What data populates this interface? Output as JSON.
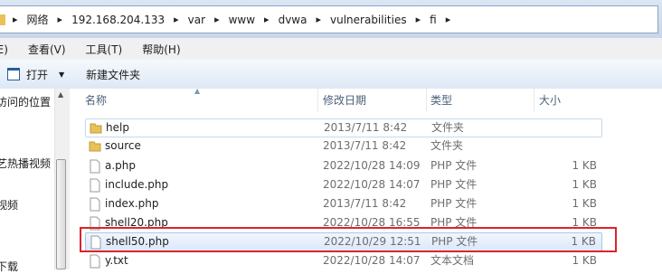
{
  "address": {
    "crumbs": [
      "网络",
      "192.168.204.133",
      "var",
      "www",
      "dvwa",
      "vulnerabilities",
      "fi"
    ]
  },
  "menu": {
    "items": [
      "编辑(E)",
      "查看(V)",
      "工具(T)",
      "帮助(H)"
    ]
  },
  "toolbar": {
    "open_label": "打开",
    "new_folder_label": "新建文件夹"
  },
  "nav": {
    "items": [
      "访问的位置",
      "艺热播视频",
      "视频",
      "下载"
    ]
  },
  "columns": {
    "name": "名称",
    "date": "修改日期",
    "type": "类型",
    "size": "大小"
  },
  "files": [
    {
      "name": "help",
      "date": "2013/7/11 8:42",
      "type": "文件夹",
      "size": "",
      "kind": "folder"
    },
    {
      "name": "source",
      "date": "2013/7/11 8:42",
      "type": "文件夹",
      "size": "",
      "kind": "folder"
    },
    {
      "name": "a.php",
      "date": "2022/10/28 14:09",
      "type": "PHP 文件",
      "size": "1 KB",
      "kind": "file"
    },
    {
      "name": "include.php",
      "date": "2022/10/28 14:07",
      "type": "PHP 文件",
      "size": "1 KB",
      "kind": "file"
    },
    {
      "name": "index.php",
      "date": "2013/7/11 8:42",
      "type": "PHP 文件",
      "size": "1 KB",
      "kind": "file"
    },
    {
      "name": "shell20.php",
      "date": "2022/10/28 16:55",
      "type": "PHP 文件",
      "size": "1 KB",
      "kind": "file"
    },
    {
      "name": "shell50.php",
      "date": "2022/10/29 12:51",
      "type": "PHP 文件",
      "size": "1 KB",
      "kind": "file"
    },
    {
      "name": "y.txt",
      "date": "2022/10/28 14:07",
      "type": "文本文档",
      "size": "1 KB",
      "kind": "file"
    }
  ],
  "colors": {
    "selection_outline": "#d9262b",
    "folder": "#e8c15a"
  }
}
